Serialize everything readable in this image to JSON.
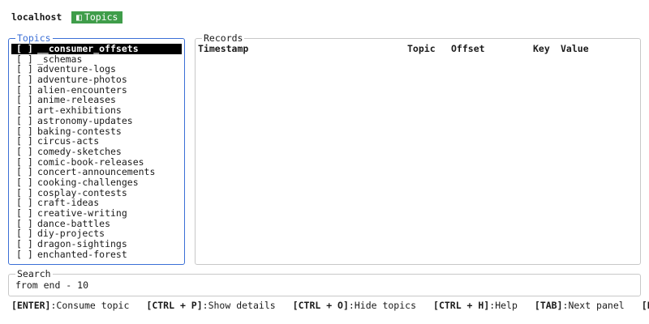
{
  "header": {
    "host": "localhost",
    "active_tab": {
      "icon": "◧",
      "label": "Topics"
    }
  },
  "topics_panel": {
    "title": "Topics",
    "selected_index": 0,
    "items": [
      {
        "check": "[ ]",
        "name": "__consumer_offsets"
      },
      {
        "check": "[ ]",
        "name": "_schemas"
      },
      {
        "check": "[ ]",
        "name": "adventure-logs"
      },
      {
        "check": "[ ]",
        "name": "adventure-photos"
      },
      {
        "check": "[ ]",
        "name": "alien-encounters"
      },
      {
        "check": "[ ]",
        "name": "anime-releases"
      },
      {
        "check": "[ ]",
        "name": "art-exhibitions"
      },
      {
        "check": "[ ]",
        "name": "astronomy-updates"
      },
      {
        "check": "[ ]",
        "name": "baking-contests"
      },
      {
        "check": "[ ]",
        "name": "circus-acts"
      },
      {
        "check": "[ ]",
        "name": "comedy-sketches"
      },
      {
        "check": "[ ]",
        "name": "comic-book-releases"
      },
      {
        "check": "[ ]",
        "name": "concert-announcements"
      },
      {
        "check": "[ ]",
        "name": "cooking-challenges"
      },
      {
        "check": "[ ]",
        "name": "cosplay-contests"
      },
      {
        "check": "[ ]",
        "name": "craft-ideas"
      },
      {
        "check": "[ ]",
        "name": "creative-writing"
      },
      {
        "check": "[ ]",
        "name": "dance-battles"
      },
      {
        "check": "[ ]",
        "name": "diy-projects"
      },
      {
        "check": "[ ]",
        "name": "dragon-sightings"
      },
      {
        "check": "[ ]",
        "name": "enchanted-forest"
      }
    ]
  },
  "records_panel": {
    "title": "Records",
    "columns": {
      "timestamp": "Timestamp",
      "topic": "Topic",
      "offset": "Offset",
      "key": "Key",
      "value": "Value"
    }
  },
  "search_panel": {
    "title": "Search",
    "value": "from end - 10"
  },
  "footer": {
    "shortcuts": [
      {
        "key": "[ENTER]",
        "desc": ":Consume topic"
      },
      {
        "key": "[CTRL + P]",
        "desc": ":Show details"
      },
      {
        "key": "[CTRL + O]",
        "desc": ":Hide topics"
      },
      {
        "key": "[CTRL + H]",
        "desc": ":Help"
      },
      {
        "key": "[TAB]",
        "desc": ":Next panel"
      },
      {
        "key": "[E",
        "desc": ""
      }
    ]
  },
  "colors": {
    "focus_border": "#3b6fd6",
    "active_tab_bg": "#3f9d4a",
    "selection_bg": "#000000"
  }
}
